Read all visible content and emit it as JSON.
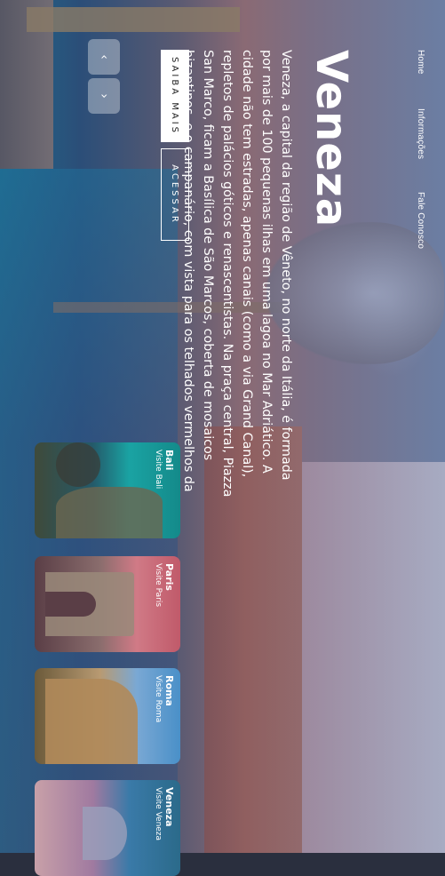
{
  "nav": {
    "home": "Home",
    "info": "Informações",
    "contact": "Fale Conosco"
  },
  "hero": {
    "title": "Veneza",
    "description": "Veneza, a capital da região de Vêneto, no norte da Itália, é formada por mais de 100 pequenas ilhas em uma lagoa no Mar Adriático. A cidade não tem estradas, apenas canais (como a via Grand Canal), repletos de palácios góticos e renascentistas. Na praça central, Piazza San Marco, ficam a Basílica de São Marcos, coberta de mosaicos bizantinos, e o campanário, com vista para os telhados vermelhos da cidade."
  },
  "buttons": {
    "saiba_mais": "SAIBA MAIS",
    "acessar": "ACESSAR"
  },
  "arrows": {
    "prev_icon": "chevron-left-icon",
    "next_icon": "chevron-right-icon"
  },
  "cards": [
    {
      "city": "Bali",
      "subtitle": "Visite Bali"
    },
    {
      "city": "Paris",
      "subtitle": "Visite Paris"
    },
    {
      "city": "Roma",
      "subtitle": "Visite Roma"
    },
    {
      "city": "Veneza",
      "subtitle": "Visite Veneza"
    }
  ]
}
